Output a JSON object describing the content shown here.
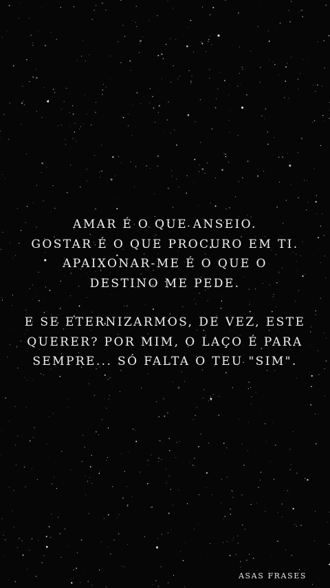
{
  "background": {
    "color": "#060606",
    "star_color": "#ffffff"
  },
  "quote": {
    "stanza_1": [
      "AMAR É O QUE ANSEIO.",
      "GOSTAR É O QUE PROCURO EM TI.",
      "APAIXONAR-ME É O QUE O",
      "DESTINO ME PEDE."
    ],
    "stanza_2": [
      "E SE ETERNIZARMOS, DE VEZ, ESTE",
      "QUERER? POR MIM, O LAÇO É PARA",
      "SEMPRE... SÓ FALTA O TEU \"SIM\"."
    ]
  },
  "watermark": "ASAS FRASES"
}
